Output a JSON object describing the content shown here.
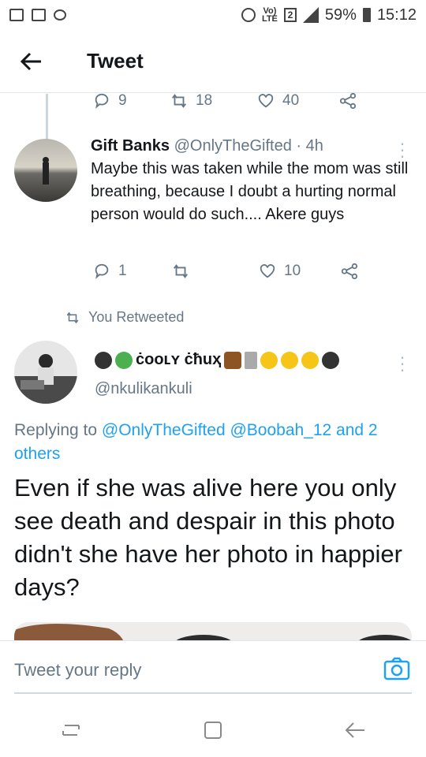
{
  "status": {
    "battery": "59%",
    "time": "15:12",
    "volte": "Vo)",
    "lte": "LTE",
    "sim": "2"
  },
  "header": {
    "title": "Tweet"
  },
  "prev_actions": {
    "replies": "9",
    "retweets": "18",
    "likes": "40"
  },
  "tweet1": {
    "name": "Gift Banks",
    "handle": "@OnlyTheGifted",
    "time": "· 4h",
    "text": "Maybe this was taken while the mom was still breathing, because I doubt a hurting normal person would do such.... Akere guys",
    "replies": "1",
    "retweets": "",
    "likes": "10"
  },
  "retweet_label": "You Retweeted",
  "tweet2": {
    "name": "ċooʟʏ ċħuҳ",
    "handle": "@nkulikankuli",
    "replying_prefix": "Replying to ",
    "replying_users": "@OnlyTheGifted @Boobah_12 and 2 others",
    "text": "Even if she was alive here you only see death and despair in this photo didn't she have her photo in happier days?"
  },
  "reply_bar": {
    "placeholder": "Tweet your reply"
  },
  "icons": {
    "back": "back-arrow-icon",
    "reply": "reply-icon",
    "retweet": "retweet-icon",
    "like": "heart-icon",
    "share": "share-icon",
    "camera": "camera-icon"
  },
  "colors": {
    "accent": "#1da1f2",
    "muted": "#657786",
    "text": "#14171a"
  }
}
